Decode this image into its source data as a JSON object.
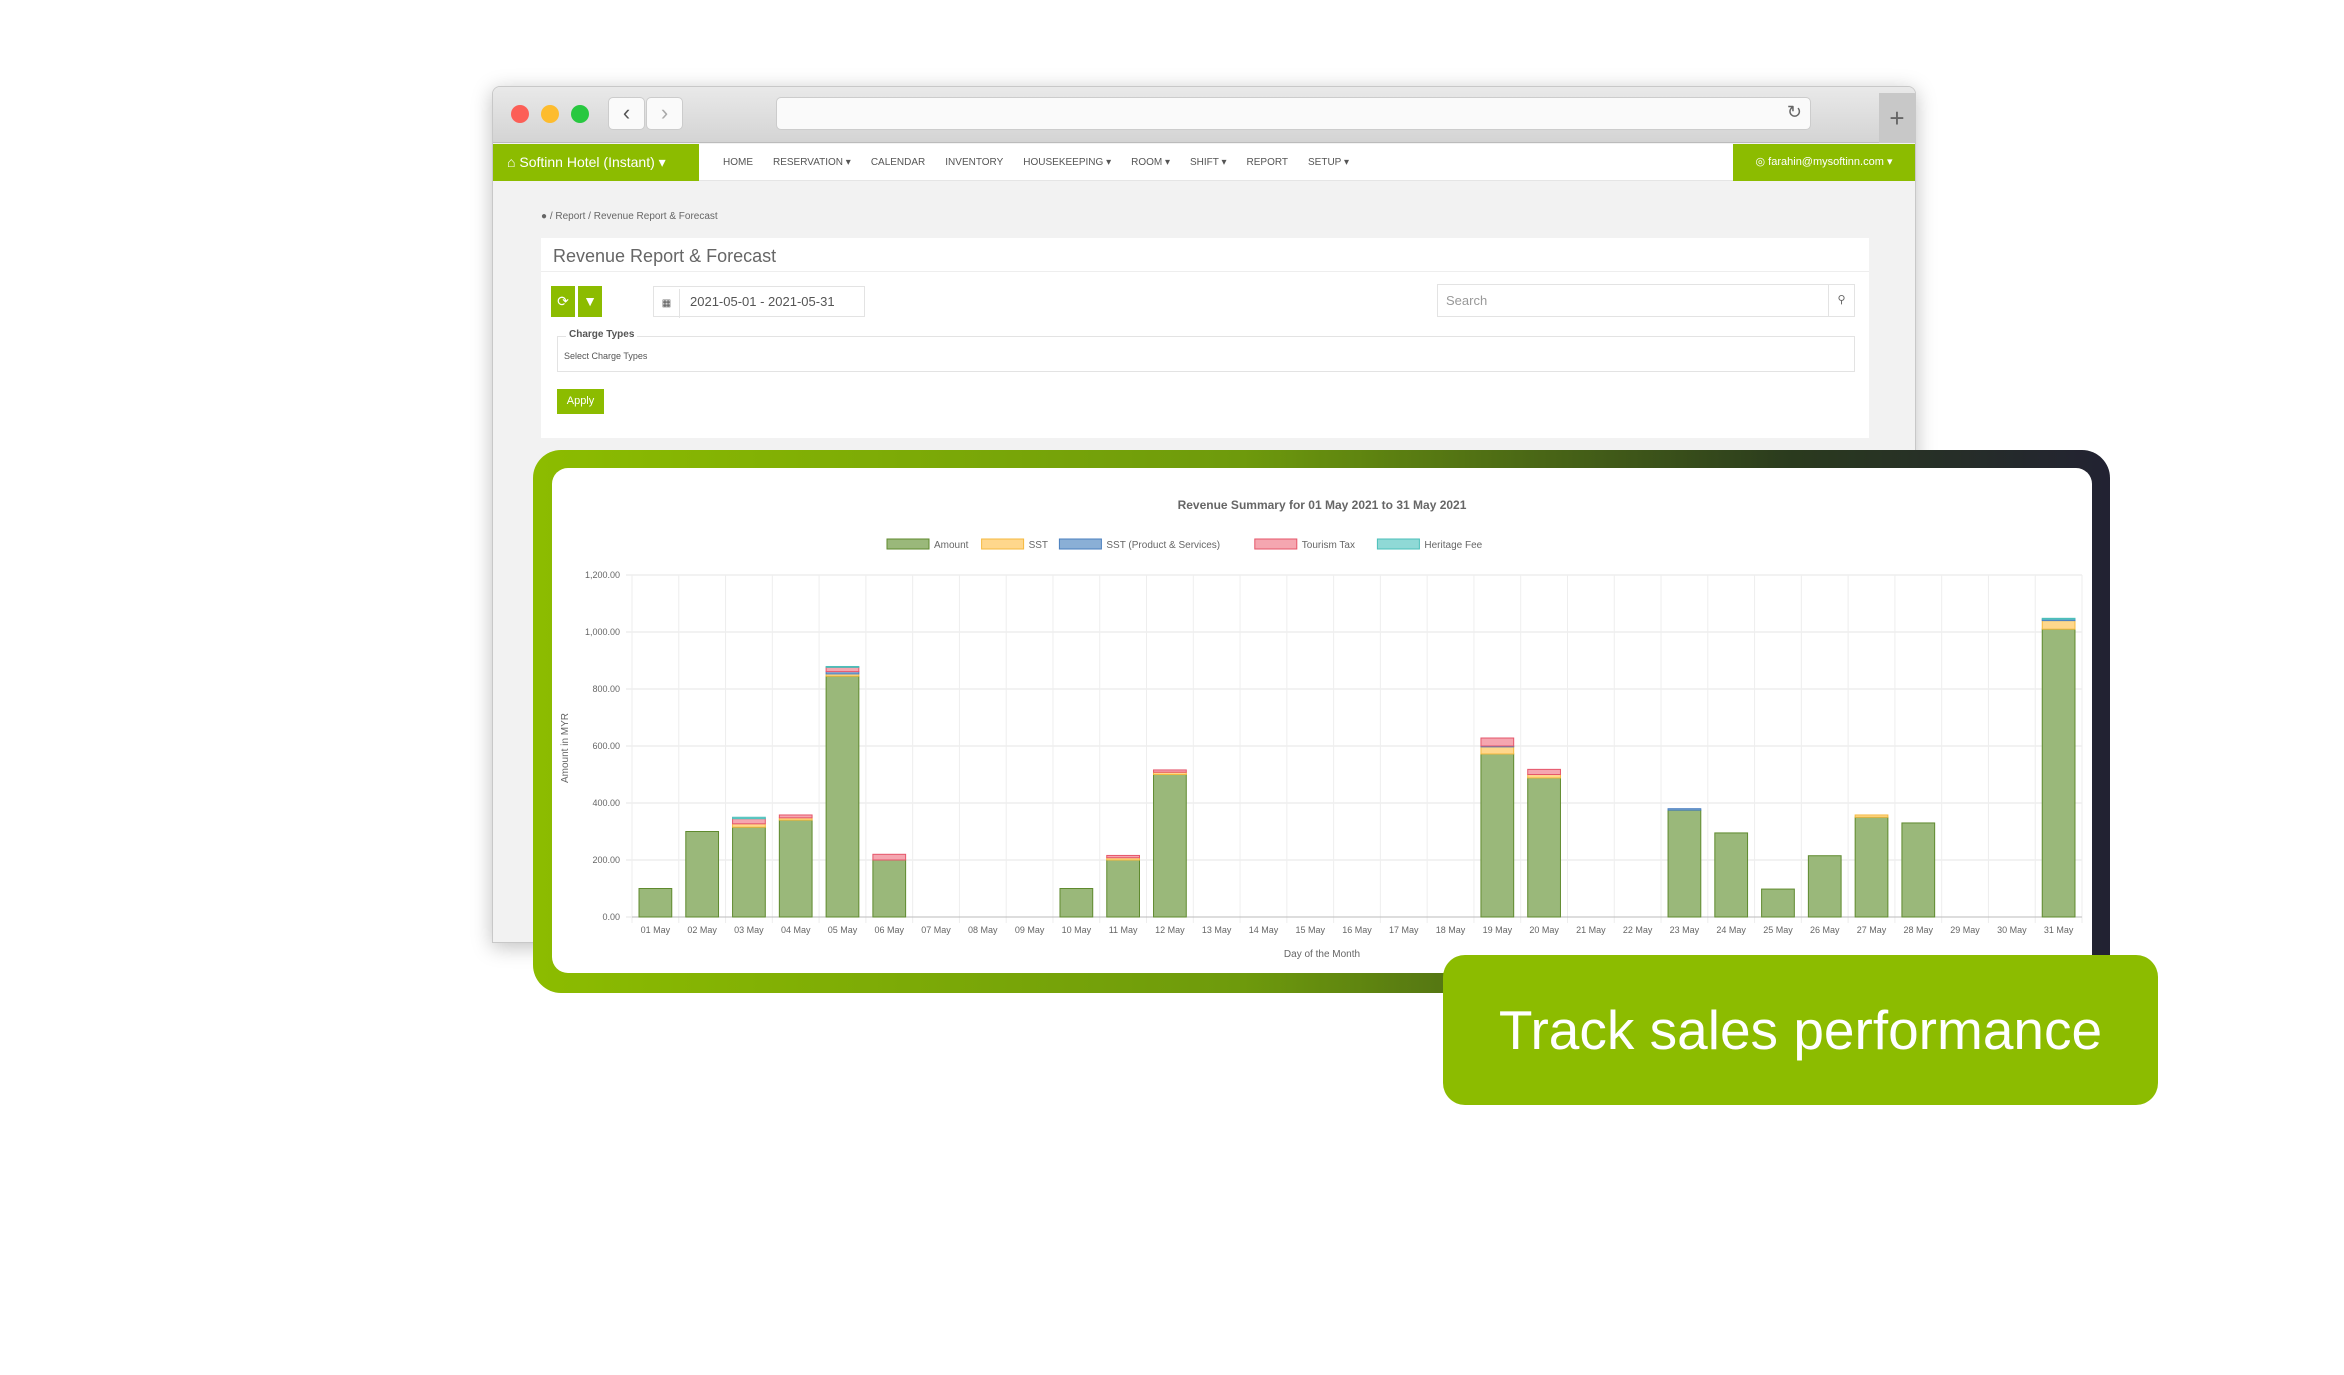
{
  "browser": {
    "back": "‹",
    "forward": "›",
    "reload": "↻",
    "new_tab": "+"
  },
  "nav": {
    "brand": "Softinn Hotel (Instant) ▾",
    "items": [
      "HOME",
      "RESERVATION ▾",
      "CALENDAR",
      "INVENTORY",
      "HOUSEKEEPING ▾",
      "ROOM ▾",
      "SHIFT ▾",
      "REPORT",
      "SETUP ▾"
    ],
    "user": "farahin@mysoftinn.com ▾"
  },
  "breadcrumb": [
    "Report",
    "Revenue Report & Forecast"
  ],
  "page": {
    "title": "Revenue Report & Forecast",
    "date_range": "2021-05-01 - 2021-05-31",
    "search_placeholder": "Search",
    "charge_types_label": "Charge Types",
    "charge_types_placeholder": "Select Charge Types",
    "apply": "Apply"
  },
  "callout": "Track sales performance",
  "colors": {
    "brand": "#8cbc00"
  },
  "chart_data": {
    "type": "bar",
    "stacked": true,
    "title": "Revenue Summary for 01 May 2021 to 31 May 2021",
    "xlabel": "Day of the Month",
    "ylabel": "Amount in MYR",
    "ylim": [
      0,
      1200
    ],
    "yticks": [
      "0.00",
      "200.00",
      "400.00",
      "600.00",
      "800.00",
      "1,000.00",
      "1,200.00"
    ],
    "grid": true,
    "legend": "top",
    "categories": [
      "01 May",
      "02 May",
      "03 May",
      "04 May",
      "05 May",
      "06 May",
      "07 May",
      "08 May",
      "09 May",
      "10 May",
      "11 May",
      "12 May",
      "13 May",
      "14 May",
      "15 May",
      "16 May",
      "17 May",
      "18 May",
      "19 May",
      "20 May",
      "21 May",
      "22 May",
      "23 May",
      "24 May",
      "25 May",
      "26 May",
      "27 May",
      "28 May",
      "29 May",
      "30 May",
      "31 May"
    ],
    "series": [
      {
        "name": "Amount",
        "color": "#9ab87a",
        "border": "#5f8a2e",
        "values": [
          100,
          300,
          315,
          340,
          845,
          200,
          0,
          0,
          0,
          100,
          200,
          500,
          0,
          0,
          0,
          0,
          0,
          0,
          572,
          488,
          0,
          0,
          375,
          295,
          98,
          215,
          350,
          330,
          0,
          0,
          1010
        ]
      },
      {
        "name": "SST",
        "color": "#ffd78c",
        "border": "#f5b93f",
        "values": [
          0,
          0,
          12,
          8,
          8,
          0,
          0,
          0,
          0,
          0,
          8,
          8,
          0,
          0,
          0,
          0,
          0,
          0,
          25,
          12,
          0,
          0,
          0,
          0,
          0,
          0,
          8,
          0,
          0,
          0,
          30
        ]
      },
      {
        "name": "SST (Product & Services)",
        "color": "#8aafd6",
        "border": "#4a7fbf",
        "values": [
          0,
          0,
          0,
          0,
          8,
          0,
          0,
          0,
          0,
          0,
          0,
          0,
          0,
          0,
          0,
          0,
          0,
          0,
          3,
          0,
          0,
          0,
          5,
          0,
          0,
          0,
          0,
          0,
          0,
          0,
          5
        ]
      },
      {
        "name": "Tourism Tax",
        "color": "#f5a6b0",
        "border": "#e5566a",
        "values": [
          0,
          0,
          18,
          10,
          15,
          20,
          0,
          0,
          0,
          0,
          8,
          8,
          0,
          0,
          0,
          0,
          0,
          0,
          28,
          18,
          0,
          0,
          0,
          0,
          0,
          0,
          0,
          0,
          0,
          0,
          0
        ]
      },
      {
        "name": "Heritage Fee",
        "color": "#8fd9d6",
        "border": "#4bbfba",
        "values": [
          0,
          0,
          5,
          0,
          3,
          0,
          0,
          0,
          0,
          0,
          0,
          0,
          0,
          0,
          0,
          0,
          0,
          0,
          0,
          0,
          0,
          0,
          0,
          0,
          0,
          0,
          0,
          0,
          0,
          0,
          3
        ]
      }
    ]
  }
}
